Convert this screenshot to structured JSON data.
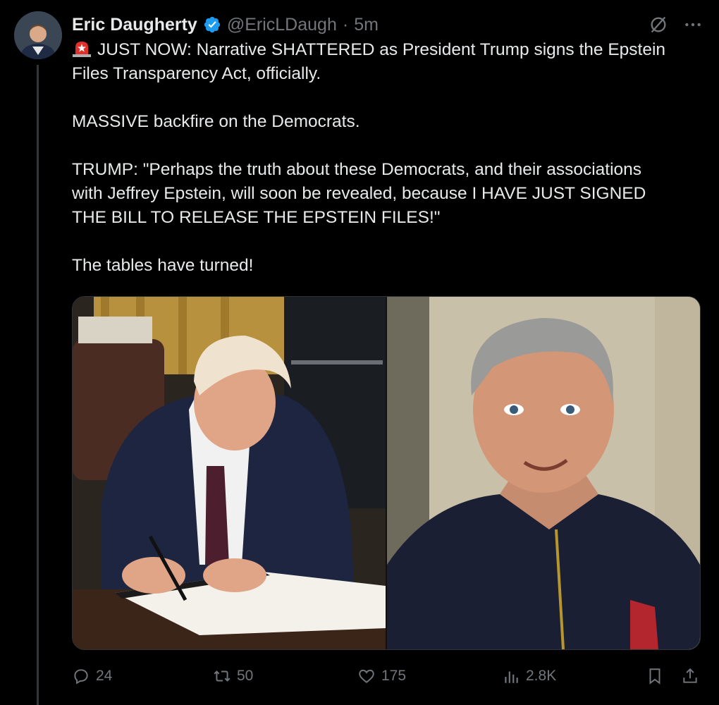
{
  "author": {
    "name": "Eric Daugherty",
    "handle": "@EricLDaugh",
    "separator": "·",
    "time": "5m"
  },
  "post": {
    "line1": "JUST NOW: Narrative SHATTERED as President Trump signs the Epstein\nFiles Transparency Act, officially.",
    "line2": "MASSIVE backfire on the Democrats.",
    "line3": "TRUMP: \"Perhaps the truth about these Democrats, and their associations\nwith Jeffrey Epstein, will soon be revealed, because I HAVE JUST SIGNED\nTHE BILL TO RELEASE THE EPSTEIN FILES!\"",
    "line4": "The tables have turned!"
  },
  "stats": {
    "replies": "24",
    "reposts": "50",
    "likes": "175",
    "views": "2.8K"
  },
  "icons": {
    "header": [
      "verified-badge-icon",
      "grok-icon",
      "more-icon"
    ],
    "actions": [
      "reply-icon",
      "repost-icon",
      "like-icon",
      "views-icon",
      "bookmark-icon",
      "share-icon"
    ],
    "inline": [
      "siren-emoji-icon"
    ]
  },
  "colors": {
    "background": "#000000",
    "text": "#e7e9ea",
    "muted": "#71767b",
    "verified": "#1d9bf0"
  }
}
